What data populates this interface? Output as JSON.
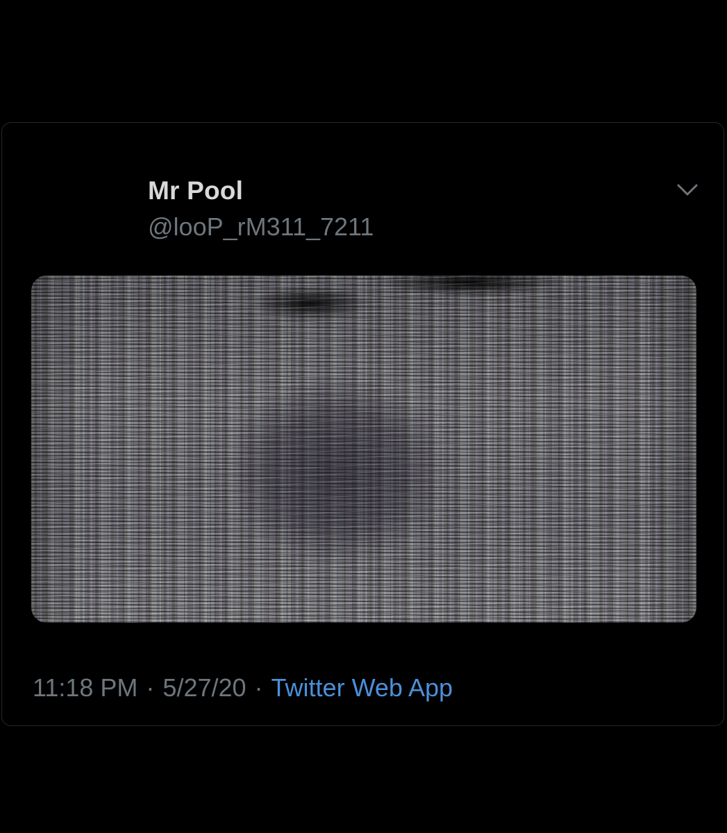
{
  "tweet": {
    "display_name": "Mr Pool",
    "handle": "@looP_rM311_7211",
    "time": "11:18 PM",
    "date": "5/27/20",
    "separator": "·",
    "source": "Twitter Web App",
    "more_icon": "chevron-down-icon",
    "media_description": "glitched-static-video-frame"
  },
  "colors": {
    "background": "#000000",
    "card_border": "#26282b",
    "primary_text": "#d9d9d9",
    "secondary_text": "#6e767d",
    "link": "#4a90d9",
    "caret": "#6e767d"
  }
}
